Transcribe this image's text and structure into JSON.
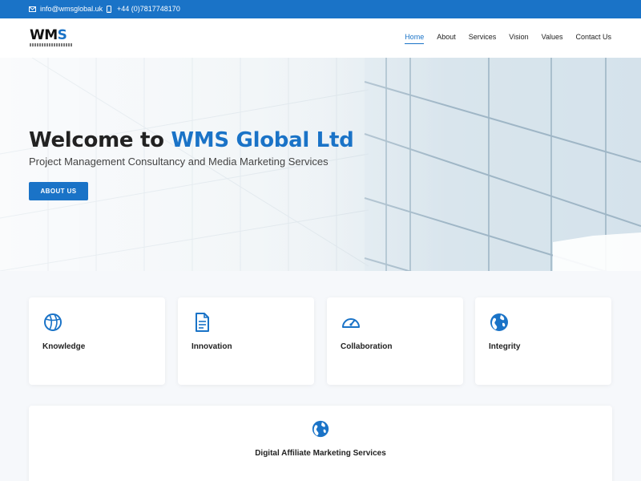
{
  "topbar": {
    "email": "info@wmsglobal.uk",
    "phone": "+44 (0)7817748170",
    "icons": [
      "envelope-icon",
      "mobile-phone-icon"
    ]
  },
  "header": {
    "logo_text": "WMS",
    "nav": [
      {
        "label": "Home",
        "active": true
      },
      {
        "label": "About",
        "active": false
      },
      {
        "label": "Services",
        "active": false
      },
      {
        "label": "Vision",
        "active": false
      },
      {
        "label": "Values",
        "active": false
      },
      {
        "label": "Contact Us",
        "active": false
      }
    ]
  },
  "hero": {
    "title_prefix": "Welcome to",
    "title_brand": "WMS Global Ltd",
    "subtitle": "Project Management Consultancy and Media Marketing Services",
    "button_label": "ABOUT US"
  },
  "features": [
    {
      "label": "Knowledge",
      "icon": "basketball-icon"
    },
    {
      "label": "Innovation",
      "icon": "document-icon"
    },
    {
      "label": "Collaboration",
      "icon": "gauge-icon"
    },
    {
      "label": "Integrity",
      "icon": "globe-icon"
    }
  ],
  "service": {
    "label": "Digital Affiliate Marketing Services",
    "icon": "globe-icon"
  },
  "colors": {
    "accent": "#1a73c7",
    "text": "#222222",
    "background": "#f6f8fb"
  }
}
